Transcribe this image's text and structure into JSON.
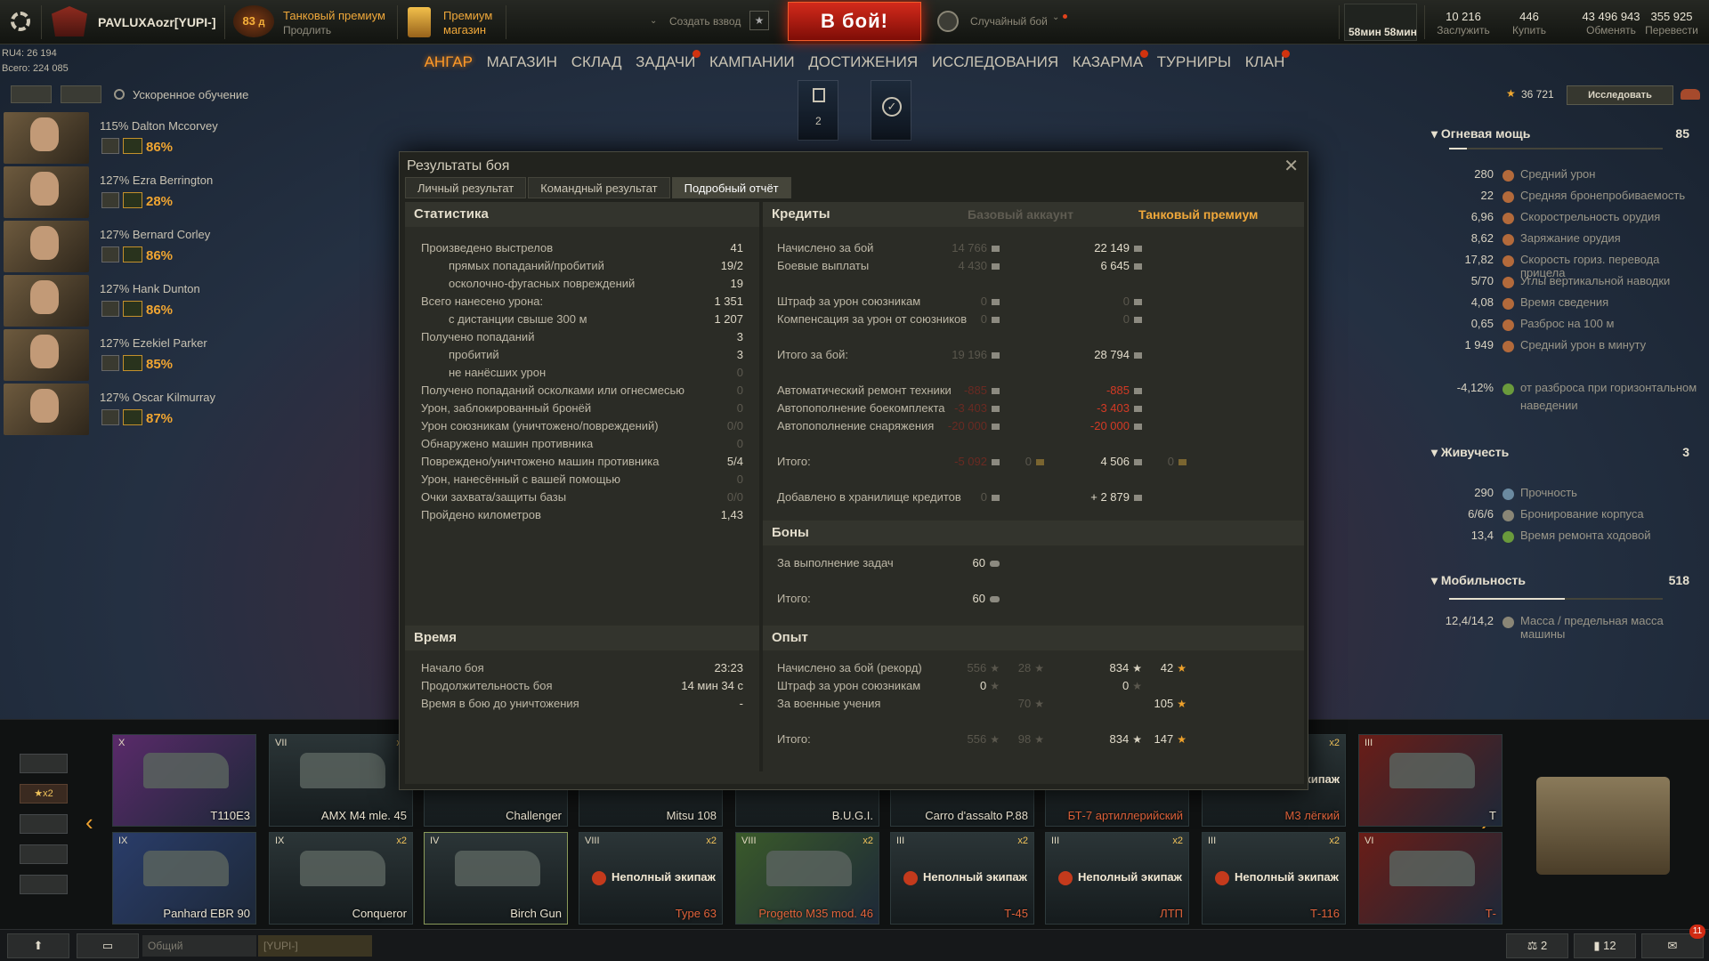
{
  "topbar": {
    "player": "PAVLUXAozr[YUPI-]",
    "level": "83",
    "level_suffix": "д",
    "premium_title": "Танковый премиум",
    "premium_action": "Продлить",
    "shop_line1": "Премиум",
    "shop_line2": "магазин",
    "create_platoon": "Создать взвод",
    "battle": "В бой!",
    "battle_mode": "Случайный бой",
    "timer1": "58мин",
    "timer2": "58мин",
    "currencies": [
      {
        "value": "10 216",
        "label": "Заслужить"
      },
      {
        "value": "446",
        "label": "Купить"
      },
      {
        "value": "43 496 943",
        "label": "Обменять"
      },
      {
        "value": "355 925",
        "label": "Перевести"
      }
    ],
    "ru4": "RU4: 26 194",
    "total": "Всего: 224 085"
  },
  "nav": [
    "АНГАР",
    "МАГАЗИН",
    "СКЛАД",
    "ЗАДАЧИ",
    "КАМПАНИИ",
    "ДОСТИЖЕНИЯ",
    "ИССЛЕДОВАНИЯ",
    "КАЗАРМА",
    "ТУРНИРЫ",
    "КЛАН"
  ],
  "accelerated": "Ускоренное обучение",
  "center_count": "2",
  "crew": [
    {
      "name": "115% Dalton Mccorvey",
      "pct": "86%"
    },
    {
      "name": "127% Ezra Berrington",
      "pct": "28%"
    },
    {
      "name": "127% Bernard Corley",
      "pct": "86%"
    },
    {
      "name": "127% Hank Dunton",
      "pct": "86%"
    },
    {
      "name": "127% Ezekiel Parker",
      "pct": "85%"
    },
    {
      "name": "127% Oscar Kilmurray",
      "pct": "87%"
    }
  ],
  "research": {
    "xp": "36 721",
    "button": "Исследовать"
  },
  "dialog": {
    "title": "Результаты боя",
    "tabs": [
      "Личный результат",
      "Командный результат",
      "Подробный отчёт"
    ],
    "stats_title": "Статистика",
    "stats": [
      [
        "Произведено выстрелов",
        "41"
      ],
      [
        "прямых попаданий/пробитий",
        "19/2"
      ],
      [
        "осколочно-фугасных повреждений",
        "19"
      ],
      [
        "Всего нанесено урона:",
        "1 351"
      ],
      [
        "с дистанции свыше 300 м",
        "1 207"
      ],
      [
        "Получено попаданий",
        "3"
      ],
      [
        "пробитий",
        "3"
      ],
      [
        "не нанёсших урон",
        "0"
      ],
      [
        "Получено попаданий осколками или огнесмесью",
        "0"
      ],
      [
        "Урон, заблокированный бронёй",
        "0"
      ],
      [
        "Урон союзникам (уничтожено/повреждений)",
        "0/0"
      ],
      [
        "Обнаружено машин противника",
        "0"
      ],
      [
        "Повреждено/уничтожено машин противника",
        "5/4"
      ],
      [
        "Урон, нанесённый с вашей помощью",
        "0"
      ],
      [
        "Очки захвата/защиты базы",
        "0/0"
      ],
      [
        "Пройдено километров",
        "1,43"
      ]
    ],
    "time_title": "Время",
    "time": [
      [
        "Начало боя",
        "23:23"
      ],
      [
        "Продолжительность боя",
        "14 мин 34 с"
      ],
      [
        "Время в бою до уничтожения",
        "-"
      ]
    ],
    "credits_title": "Кредиты",
    "col_base": "Базовый аккаунт",
    "col_prem": "Танковый премиум",
    "credits": [
      {
        "label": "Начислено за бой",
        "base": "14 766",
        "prem": "22 149",
        "cls": "n"
      },
      {
        "label": "Боевые выплаты",
        "base": "4 430",
        "prem": "6 645",
        "cls": "n"
      },
      {
        "label": "Штраф за урон союзникам",
        "base": "0",
        "prem": "0",
        "cls": "z"
      },
      {
        "label": "Компенсация за урон от союзников",
        "base": "0",
        "prem": "0",
        "cls": "z"
      },
      {
        "label": "Итого за бой:",
        "base": "19 196",
        "prem": "28 794",
        "cls": "n"
      },
      {
        "label": "Автоматический ремонт техники",
        "base": "-885",
        "prem": "-885",
        "cls": "r"
      },
      {
        "label": "Автопополнение боекомплекта",
        "base": "-3 403",
        "prem": "-3 403",
        "cls": "r"
      },
      {
        "label": "Автопополнение снаряжения",
        "base": "-20 000",
        "prem": "-20 000",
        "cls": "r"
      },
      {
        "label": "Итого:",
        "base": "-5 092",
        "base2": "0",
        "prem": "4 506",
        "prem2": "0",
        "cls": "t"
      },
      {
        "label": "Добавлено в хранилище кредитов",
        "base": "0",
        "prem": "+ 2 879",
        "cls": "n"
      }
    ],
    "bonds_title": "Боны",
    "bonds": [
      [
        "За выполнение задач",
        "60"
      ],
      [
        "Итого:",
        "60"
      ]
    ],
    "xp_title": "Опыт",
    "xp": [
      {
        "label": "Начислено за бой (рекорд)",
        "b1": "556",
        "b2": "28",
        "p1": "834",
        "p2": "42"
      },
      {
        "label": "Штраф за урон союзникам",
        "b1": "0",
        "b2": "",
        "p1": "0",
        "p2": ""
      },
      {
        "label": "За военные учения",
        "b1": "",
        "b2": "70",
        "p1": "",
        "p2": "105"
      },
      {
        "label": "Итого:",
        "b1": "556",
        "b2": "98",
        "p1": "834",
        "p2": "147"
      }
    ]
  },
  "rightpanel": {
    "firepower": "Огневая мощь",
    "firepower_val": "85",
    "fire_stats": [
      [
        "280",
        "Средний урон"
      ],
      [
        "22",
        "Средняя бронепробиваемость"
      ],
      [
        "6,96",
        "Скорострельность орудия"
      ],
      [
        "8,62",
        "Заряжание орудия"
      ],
      [
        "17,82",
        "Скорость гориз. перевода прицела"
      ],
      [
        "5/70",
        "Углы вертикальной наводки"
      ],
      [
        "4,08",
        "Время сведения"
      ],
      [
        "0,65",
        "Разброс на 100 м"
      ],
      [
        "1 949",
        "Средний урон в минуту"
      ],
      [
        "-4,12%",
        "от разброса при горизонтальном"
      ]
    ],
    "fire_stats_extra": "наведении",
    "survival": "Живучесть",
    "survival_val": "3",
    "surv_stats": [
      [
        "290",
        "Прочность"
      ],
      [
        "6/6/6",
        "Бронирование корпуса"
      ],
      [
        "13,4",
        "Время ремонта ходовой"
      ]
    ],
    "mobility": "Мобильность",
    "mobility_val": "518",
    "mob_stats": [
      [
        "12,4/14,2",
        "Масса / предельная масса машины"
      ]
    ]
  },
  "carousel": {
    "row1": [
      {
        "tier": "X",
        "name": "T110E3",
        "x2": ""
      },
      {
        "tier": "VII",
        "name": "AMX M4 mle. 45",
        "x2": "x2"
      },
      {
        "tier": "",
        "name": "Challenger",
        "x2": ""
      },
      {
        "tier": "",
        "name": "Mitsu 108",
        "x2": ""
      },
      {
        "tier": "",
        "name": "B.U.G.I.",
        "x2": ""
      },
      {
        "tier": "",
        "name": "Carro d'assalto P.88",
        "x2": ""
      },
      {
        "tier": "",
        "name": "БТ-7 артиллерийский",
        "x2": ""
      },
      {
        "tier": "",
        "name": "М3 лёгкий",
        "x2": "x2"
      },
      {
        "tier": "III",
        "name": "Т",
        "x2": ""
      }
    ],
    "row2": [
      {
        "tier": "IX",
        "name": "Panhard EBR 90",
        "x2": "",
        "warn": ""
      },
      {
        "tier": "IX",
        "name": "Conqueror",
        "x2": "x2",
        "warn": ""
      },
      {
        "tier": "IV",
        "name": "Birch Gun",
        "x2": "",
        "warn": ""
      },
      {
        "tier": "VIII",
        "name": "Type 63",
        "x2": "x2",
        "warn": "Неполный экипаж"
      },
      {
        "tier": "VIII",
        "name": "Progetto M35 mod. 46",
        "x2": "x2",
        "warn": ""
      },
      {
        "tier": "III",
        "name": "Т-45",
        "x2": "x2",
        "warn": "Неполный экипаж"
      },
      {
        "tier": "III",
        "name": "ЛТП",
        "x2": "x2",
        "warn": "Неполный экипаж"
      },
      {
        "tier": "III",
        "name": "Т-116",
        "x2": "x2",
        "warn": "Неполный экипаж"
      },
      {
        "tier": "VI",
        "name": "Т-",
        "x2": "",
        "warn": ""
      }
    ],
    "filter_x2": "x2",
    "partial_label": "кипаж"
  },
  "bottombar": {
    "chat_general": "Общий",
    "chat_clan": "[YUPI-]",
    "platoons": "2",
    "stats": "12",
    "notif": "11"
  }
}
